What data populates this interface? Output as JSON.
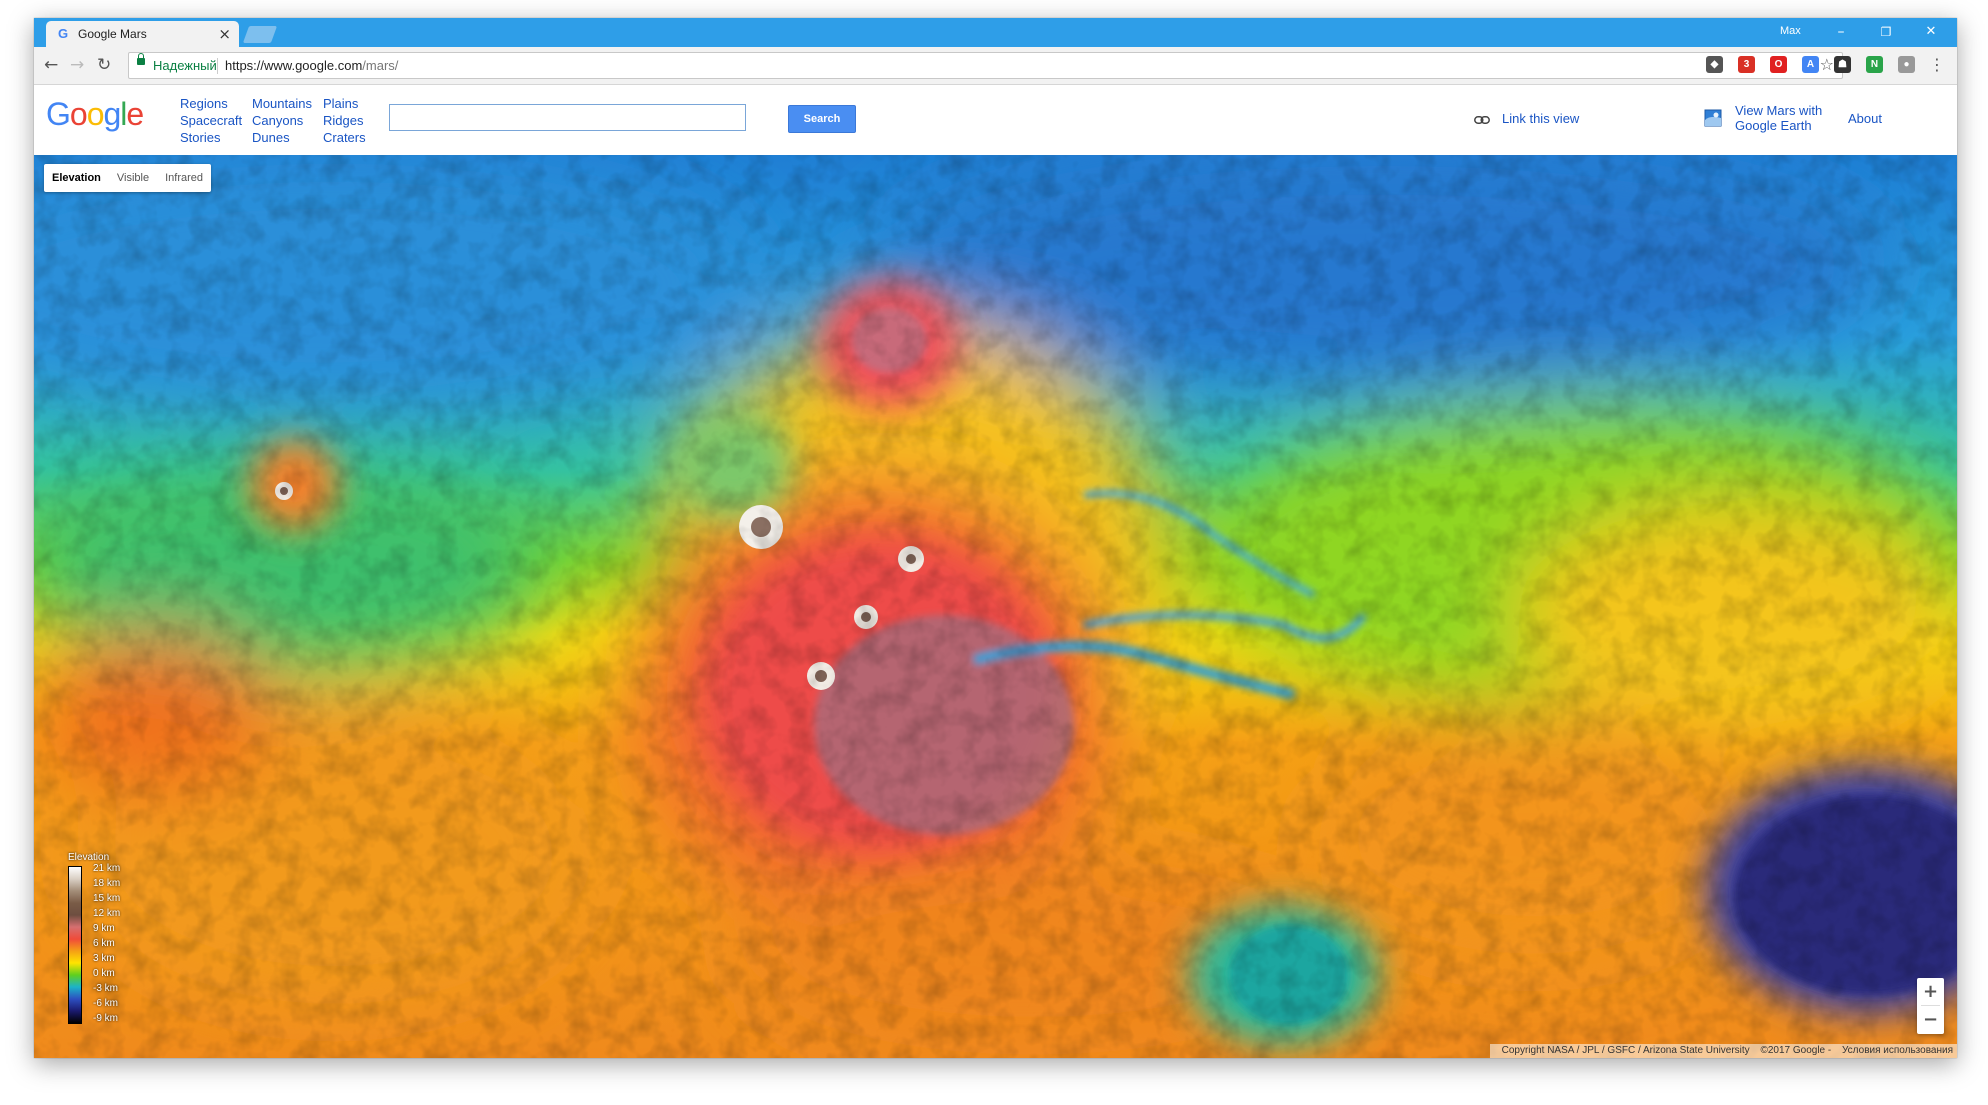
{
  "browser": {
    "tab_title": "Google Mars",
    "tab_favicon": "G",
    "user_name": "Max",
    "secure_label": "Надежный",
    "url_host": "https://www.google.com",
    "url_path": "/mars/",
    "minimize": "–",
    "restore": "❐",
    "close": "✕",
    "extensions": [
      {
        "name": "pocket-icon",
        "color": "#555555",
        "glyph": "◆"
      },
      {
        "name": "ext-red-icon",
        "color": "#d93025",
        "glyph": "3"
      },
      {
        "name": "opera-icon",
        "color": "#e02020",
        "glyph": "O"
      },
      {
        "name": "translate-icon",
        "color": "#4285f4",
        "glyph": "A"
      },
      {
        "name": "ghost-icon",
        "color": "#333333",
        "glyph": "☗"
      },
      {
        "name": "new-ext-icon",
        "color": "#2aa44a",
        "glyph": "N"
      },
      {
        "name": "shield-icon",
        "color": "#999999",
        "glyph": "●"
      }
    ]
  },
  "header": {
    "nav_col1": [
      "Regions",
      "Spacecraft",
      "Stories"
    ],
    "nav_col2": [
      "Mountains",
      "Canyons",
      "Dunes"
    ],
    "nav_col3": [
      "Plains",
      "Ridges",
      "Craters"
    ],
    "search_value": "",
    "search_button": "Search",
    "link_this_view": "Link this view",
    "view_earth_line1": "View Mars with",
    "view_earth_line2": "Google Earth",
    "about": "About"
  },
  "map": {
    "types": [
      "Elevation",
      "Visible",
      "Infrared"
    ],
    "active_type": "Elevation",
    "legend_title": "Elevation",
    "legend_labels": [
      "21 km",
      "18 km",
      "15 km",
      "12 km",
      "9 km",
      "6 km",
      "3 km",
      "0 km",
      "-3 km",
      "-6 km",
      "-9 km"
    ],
    "zoom_in": "+",
    "zoom_out": "−",
    "copyright": "Copyright NASA / JPL / GSFC / Arizona State University",
    "year_text": "©2017 Google -",
    "terms": "Условия использования"
  },
  "colors": {
    "titlebar": "#2e9ee8",
    "link": "#1a55c4",
    "search_button": "#4a8ef2"
  }
}
